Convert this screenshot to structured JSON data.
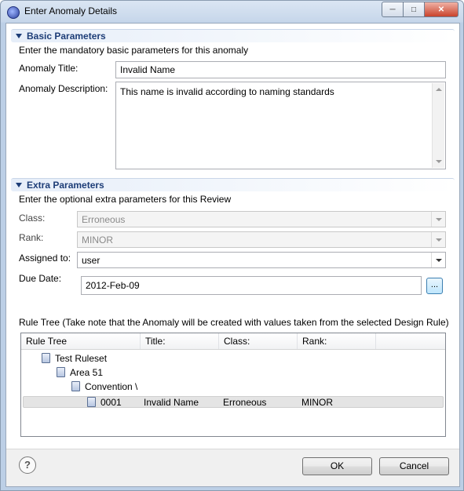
{
  "window": {
    "title": "Enter Anomaly Details"
  },
  "basic": {
    "header": "Basic Parameters",
    "intro": "Enter the mandatory basic parameters for this anomaly",
    "title_label": "Anomaly Title:",
    "title_value": "Invalid Name",
    "desc_label": "Anomaly Description:",
    "desc_value": "This name is invalid according to naming standards"
  },
  "extra": {
    "header": "Extra Parameters",
    "intro": "Enter the optional extra parameters for this Review",
    "class_label": "Class:",
    "class_value": "Erroneous",
    "rank_label": "Rank:",
    "rank_value": "MINOR",
    "assigned_label": "Assigned to:",
    "assigned_value": "user",
    "due_label": "Due Date:",
    "due_value": "2012-Feb-09",
    "date_button": "..."
  },
  "rule_tree": {
    "caption": "Rule Tree (Take note that the Anomaly will be created with values taken from the selected Design Rule)",
    "columns": [
      "Rule Tree",
      "Title:",
      "Class:",
      "Rank:"
    ],
    "nodes": [
      {
        "label": "Test Ruleset"
      },
      {
        "label": "Area 51"
      },
      {
        "label": "Convention \\"
      },
      {
        "label": "0001",
        "title": "Invalid Name",
        "class": "Erroneous",
        "rank": "MINOR",
        "selected": true
      }
    ]
  },
  "buttons": {
    "help": "?",
    "ok": "OK",
    "cancel": "Cancel"
  },
  "icons": {
    "app": "eclipse-icon",
    "node": "rule-icon"
  },
  "colors": {
    "section_header_text": "#1d3d77",
    "selection": "#e4e4e4",
    "border": "#abadb3"
  }
}
